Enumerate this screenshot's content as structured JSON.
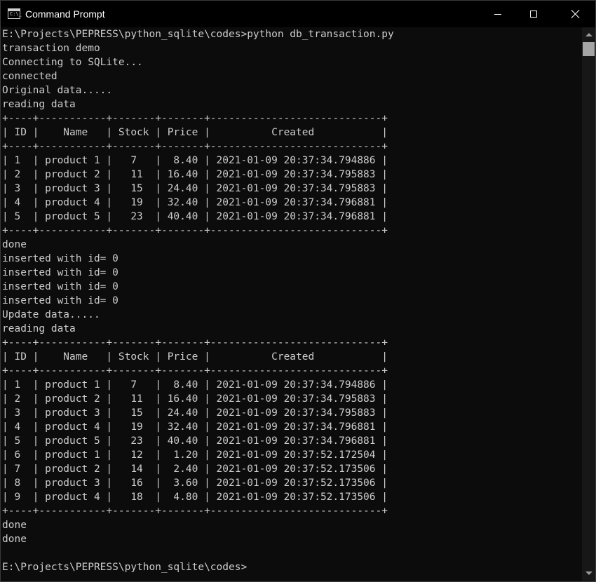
{
  "window": {
    "title": "Command Prompt",
    "icon": "console-icon",
    "icon_glyph": "C:\\_"
  },
  "controls": {
    "minimize": "minimize-icon",
    "maximize": "maximize-icon",
    "close": "close-icon"
  },
  "console": {
    "lines": [
      "E:\\Projects\\PEPRESS\\python_sqlite\\codes>python db_transaction.py",
      "transaction demo",
      "Connecting to SQLite...",
      "connected",
      "Original data.....",
      "reading data",
      "+----+-----------+-------+-------+----------------------------+",
      "| ID |    Name   | Stock | Price |          Created           |",
      "+----+-----------+-------+-------+----------------------------+",
      "| 1  | product 1 |   7   |  8.40 | 2021-01-09 20:37:34.794886 |",
      "| 2  | product 2 |   11  | 16.40 | 2021-01-09 20:37:34.795883 |",
      "| 3  | product 3 |   15  | 24.40 | 2021-01-09 20:37:34.795883 |",
      "| 4  | product 4 |   19  | 32.40 | 2021-01-09 20:37:34.796881 |",
      "| 5  | product 5 |   23  | 40.40 | 2021-01-09 20:37:34.796881 |",
      "+----+-----------+-------+-------+----------------------------+",
      "done",
      "inserted with id= 0",
      "inserted with id= 0",
      "inserted with id= 0",
      "inserted with id= 0",
      "Update data.....",
      "reading data",
      "+----+-----------+-------+-------+----------------------------+",
      "| ID |    Name   | Stock | Price |          Created           |",
      "+----+-----------+-------+-------+----------------------------+",
      "| 1  | product 1 |   7   |  8.40 | 2021-01-09 20:37:34.794886 |",
      "| 2  | product 2 |   11  | 16.40 | 2021-01-09 20:37:34.795883 |",
      "| 3  | product 3 |   15  | 24.40 | 2021-01-09 20:37:34.795883 |",
      "| 4  | product 4 |   19  | 32.40 | 2021-01-09 20:37:34.796881 |",
      "| 5  | product 5 |   23  | 40.40 | 2021-01-09 20:37:34.796881 |",
      "| 6  | product 1 |   12  |  1.20 | 2021-01-09 20:37:52.172504 |",
      "| 7  | product 2 |   14  |  2.40 | 2021-01-09 20:37:52.173506 |",
      "| 8  | product 3 |   16  |  3.60 | 2021-01-09 20:37:52.173506 |",
      "| 9  | product 4 |   18  |  4.80 | 2021-01-09 20:37:52.173506 |",
      "+----+-----------+-------+-------+----------------------------+",
      "done",
      "done",
      "",
      "E:\\Projects\\PEPRESS\\python_sqlite\\codes>"
    ]
  },
  "scrollbar": {
    "up_icon": "scroll-up-arrow-icon",
    "down_icon": "scroll-down-arrow-icon"
  },
  "colors": {
    "background": "#0c0c0c",
    "text": "#cccccc",
    "titlebar": "#000000"
  }
}
